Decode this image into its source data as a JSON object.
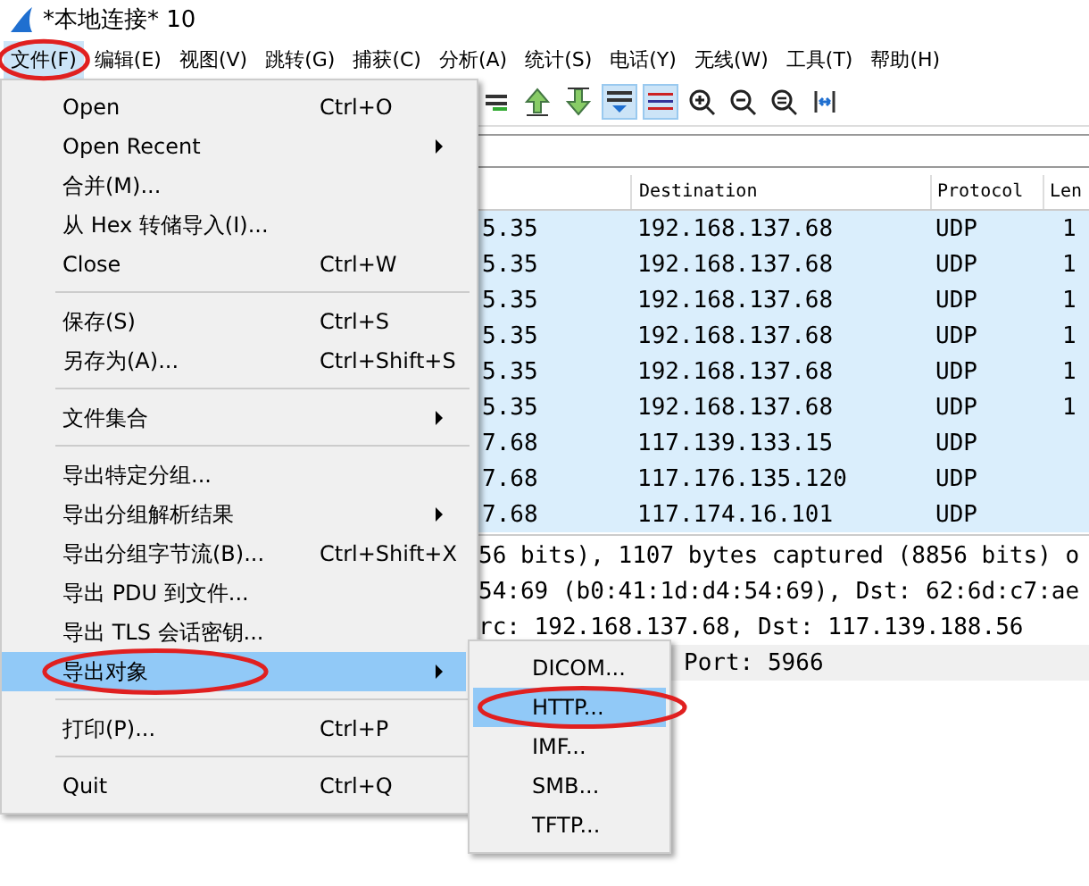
{
  "window": {
    "title": "*本地连接* 10"
  },
  "menubar": [
    {
      "label": "文件(F)",
      "open": true,
      "circled": true
    },
    {
      "label": "编辑(E)",
      "open": false,
      "circled": false
    },
    {
      "label": "视图(V)",
      "open": false,
      "circled": false
    },
    {
      "label": "跳转(G)",
      "open": false,
      "circled": false
    },
    {
      "label": "捕获(C)",
      "open": false,
      "circled": false
    },
    {
      "label": "分析(A)",
      "open": false,
      "circled": false
    },
    {
      "label": "统计(S)",
      "open": false,
      "circled": false
    },
    {
      "label": "电话(Y)",
      "open": false,
      "circled": false
    },
    {
      "label": "无线(W)",
      "open": false,
      "circled": false
    },
    {
      "label": "工具(T)",
      "open": false,
      "circled": false
    },
    {
      "label": "帮助(H)",
      "open": false,
      "circled": false
    }
  ],
  "toolbar": [
    {
      "kind": "jump",
      "pressed": false
    },
    {
      "kind": "up",
      "pressed": false
    },
    {
      "kind": "down",
      "pressed": false
    },
    {
      "kind": "autoscroll",
      "pressed": true
    },
    {
      "kind": "colorize",
      "pressed": true
    },
    {
      "kind": "zoom-in",
      "pressed": false
    },
    {
      "kind": "zoom-out",
      "pressed": false
    },
    {
      "kind": "zoom-reset",
      "pressed": false
    },
    {
      "kind": "resize",
      "pressed": false
    }
  ],
  "packet_list": {
    "columns": [
      {
        "label": "Destination"
      },
      {
        "label": "Protocol"
      },
      {
        "label": "Len"
      }
    ],
    "rows": [
      {
        "column_1": "5.35",
        "destination": "192.168.137.68",
        "protocol": "UDP",
        "length": "1"
      },
      {
        "column_1": "5.35",
        "destination": "192.168.137.68",
        "protocol": "UDP",
        "length": "1"
      },
      {
        "column_1": "5.35",
        "destination": "192.168.137.68",
        "protocol": "UDP",
        "length": "1"
      },
      {
        "column_1": "5.35",
        "destination": "192.168.137.68",
        "protocol": "UDP",
        "length": "1"
      },
      {
        "column_1": "5.35",
        "destination": "192.168.137.68",
        "protocol": "UDP",
        "length": "1"
      },
      {
        "column_1": "5.35",
        "destination": "192.168.137.68",
        "protocol": "UDP",
        "length": "1"
      },
      {
        "column_1": "7.68",
        "destination": "117.139.133.15",
        "protocol": "UDP"
      },
      {
        "column_1": "7.68",
        "destination": "117.176.135.120",
        "protocol": "UDP"
      },
      {
        "column_1": "7.68",
        "destination": "117.174.16.101",
        "protocol": "UDP"
      }
    ]
  },
  "details": [
    {
      "kind": "line",
      "text": "56 bits), 1107 bytes captured (8856 bits) o",
      "selected": false
    },
    {
      "kind": "line",
      "text": "54:69 (b0:41:1d:d4:54:69), Dst: 62:6d:c7:ae",
      "selected": false
    },
    {
      "kind": "line",
      "text": "rc: 192.168.137.68, Dst: 117.139.188.56",
      "selected": false
    },
    {
      "kind": "tail",
      "text": "Port: 5966",
      "selected": true
    }
  ],
  "file_menu": {
    "items": [
      {
        "kind": "item",
        "label": "Open",
        "shortcut": "Ctrl+O",
        "submenu": false,
        "selected": false,
        "circled": false
      },
      {
        "kind": "item",
        "label": "Open Recent",
        "submenu": true,
        "selected": false,
        "circled": false
      },
      {
        "kind": "item",
        "label": "合并(M)...",
        "submenu": false,
        "selected": false,
        "circled": false
      },
      {
        "kind": "item",
        "label": "从 Hex 转储导入(I)...",
        "submenu": false,
        "selected": false,
        "circled": false
      },
      {
        "kind": "item",
        "label": "Close",
        "shortcut": "Ctrl+W",
        "submenu": false,
        "selected": false,
        "circled": false
      },
      {
        "kind": "separator"
      },
      {
        "kind": "item",
        "label": "保存(S)",
        "shortcut": "Ctrl+S",
        "submenu": false,
        "selected": false,
        "circled": false
      },
      {
        "kind": "item",
        "label": "另存为(A)...",
        "shortcut": "Ctrl+Shift+S",
        "submenu": false,
        "selected": false,
        "circled": false
      },
      {
        "kind": "separator"
      },
      {
        "kind": "item",
        "label": "文件集合",
        "submenu": true,
        "selected": false,
        "circled": false
      },
      {
        "kind": "separator"
      },
      {
        "kind": "item",
        "label": "导出特定分组...",
        "submenu": false,
        "selected": false,
        "circled": false
      },
      {
        "kind": "item",
        "label": "导出分组解析结果",
        "submenu": true,
        "selected": false,
        "circled": false
      },
      {
        "kind": "item",
        "label": "导出分组字节流(B)...",
        "shortcut": "Ctrl+Shift+X",
        "submenu": false,
        "selected": false,
        "circled": false
      },
      {
        "kind": "item",
        "label": "导出 PDU 到文件...",
        "submenu": false,
        "selected": false,
        "circled": false
      },
      {
        "kind": "item",
        "label": "导出 TLS 会话密钥...",
        "submenu": false,
        "selected": false,
        "circled": false
      },
      {
        "kind": "item",
        "label": "导出对象",
        "submenu": true,
        "selected": true,
        "circled": true
      },
      {
        "kind": "separator"
      },
      {
        "kind": "item",
        "label": "打印(P)...",
        "shortcut": "Ctrl+P",
        "submenu": false,
        "selected": false,
        "circled": false
      },
      {
        "kind": "separator"
      },
      {
        "kind": "item",
        "label": "Quit",
        "shortcut": "Ctrl+Q",
        "submenu": false,
        "selected": false,
        "circled": false
      }
    ]
  },
  "export_objects_menu": {
    "items": [
      {
        "label": "DICOM...",
        "selected": false,
        "circled": false
      },
      {
        "label": "HTTP...",
        "selected": true,
        "circled": true
      },
      {
        "label": "IMF...",
        "selected": false,
        "circled": false
      },
      {
        "label": "SMB...",
        "selected": false,
        "circled": false
      },
      {
        "label": "TFTP...",
        "selected": false,
        "circled": false
      }
    ]
  }
}
